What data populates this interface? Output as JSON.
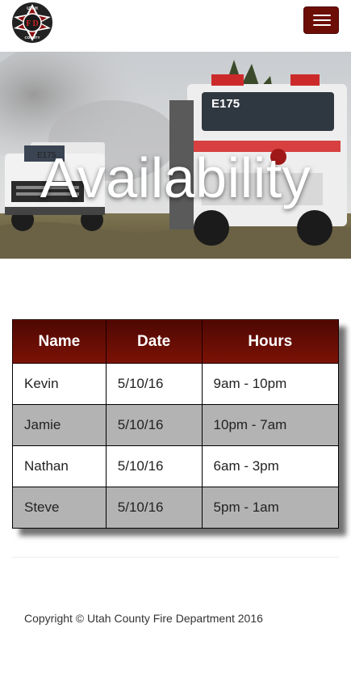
{
  "nav": {
    "logo_top_text": "UTAH",
    "logo_bottom_text": "COUNTY",
    "logo_letters": "F D",
    "menu_icon": "hamburger-menu-icon"
  },
  "hero": {
    "title": "Availability",
    "truck_label_left": "E175",
    "truck_label_right": "E175"
  },
  "table": {
    "headers": [
      "Name",
      "Date",
      "Hours"
    ],
    "rows": [
      [
        "Kevin",
        "5/10/16",
        "9am - 10pm"
      ],
      [
        "Jamie",
        "5/10/16",
        "10pm - 7am"
      ],
      [
        "Nathan",
        "5/10/16",
        "6am - 3pm"
      ],
      [
        "Steve",
        "5/10/16",
        "5pm - 1am"
      ]
    ]
  },
  "footer": {
    "copyright": "Copyright © Utah County Fire Department 2016"
  },
  "colors": {
    "brand": "#6d0e06",
    "header_dark": "#4f0803",
    "row_alt": "#b3b3b3"
  }
}
